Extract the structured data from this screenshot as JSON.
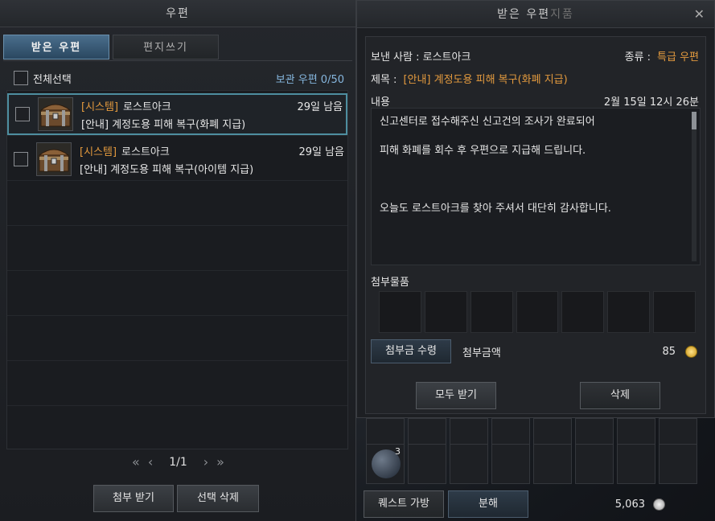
{
  "left_window": {
    "title": "우편",
    "tabs": [
      {
        "label": "받은 우편",
        "active": true
      },
      {
        "label": "편지쓰기",
        "active": false
      }
    ],
    "select_all_label": "전체선택",
    "storage": "보관 우편 0/50",
    "mails": [
      {
        "tag": "[시스템]",
        "sender": "로스트아크",
        "days_left": "29일 남음",
        "subject": "[안내] 계정도용 피해 복구(화폐 지급)",
        "selected": true,
        "icon": "treasure-chest-icon"
      },
      {
        "tag": "[시스템]",
        "sender": "로스트아크",
        "days_left": "29일 남음",
        "subject": "[안내] 계정도용 피해 복구(아이템 지급)",
        "selected": false,
        "icon": "treasure-chest-icon"
      }
    ],
    "pagination": {
      "page": "1/1"
    },
    "buttons": {
      "receive_attach": "첨부 받기",
      "delete_selected": "선택 삭제"
    }
  },
  "right_window": {
    "title": "받은 우편",
    "title_overlap": "지품",
    "sender_label": "보낸 사람 : 로스트아크",
    "type_label": "종류 :",
    "type_value": "특급 우편",
    "subject_label": "제목 :",
    "subject_value": "[안내] 계정도용 피해 복구(화폐 지급)",
    "content_label": "내용",
    "date": "2월 15일 12시 26분",
    "body_lines": [
      "신고센터로 접수해주신 신고건의 조사가 완료되어",
      "피해 화폐를 회수 후 우편으로 지급해 드립니다.",
      "오늘도 로스트아크를 찾아 주셔서 대단히 감사합니다."
    ],
    "attachments_label": "첨부물품",
    "attach_money_button": "첨부금 수령",
    "attach_money_label": "첨부금액",
    "attach_money_value": "85",
    "buttons": {
      "receive_all": "모두 받기",
      "delete": "삭제"
    }
  },
  "bottom_bar": {
    "quest_bag": "퀘스트 가방",
    "disassemble": "분해",
    "silver": "5,063",
    "inventory_stack_count": "3"
  },
  "colors": {
    "accent_orange": "#e39a3e",
    "storage_blue": "#86b7de",
    "tab_active": "#4a6e8c"
  }
}
